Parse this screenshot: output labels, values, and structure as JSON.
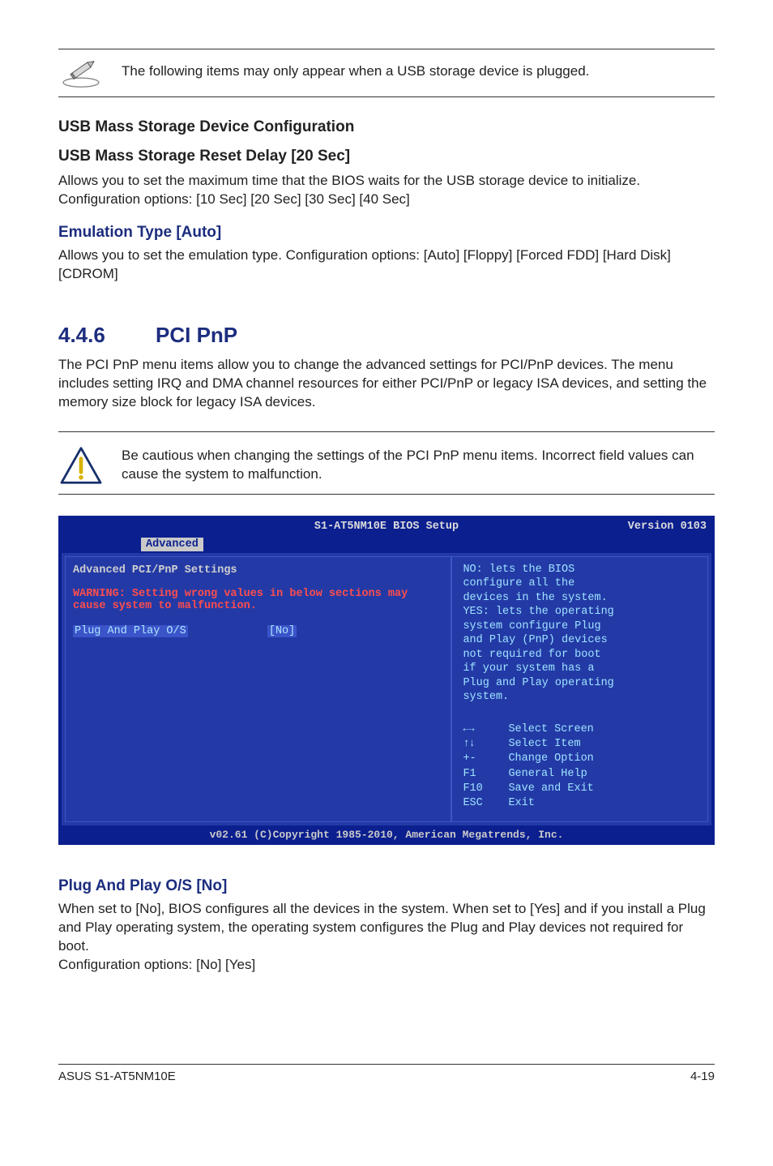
{
  "note_top": {
    "text": "The following items may only appear when a USB storage device is plugged."
  },
  "usb_conf": {
    "heading": "USB Mass Storage Device Configuration",
    "reset_heading": "USB Mass Storage Reset Delay [20 Sec]",
    "reset_body": "Allows you to set the maximum time that the BIOS waits for the USB storage device to initialize. Configuration options: [10 Sec] [20 Sec] [30 Sec] [40 Sec]",
    "emul_heading": "Emulation Type [Auto]",
    "emul_body": "Allows you to set the emulation type. Configuration options: [Auto] [Floppy] [Forced FDD] [Hard Disk] [CDROM]"
  },
  "section": {
    "num": "4.4.6",
    "title": "PCI PnP",
    "body": "The PCI PnP menu items allow you to change the advanced settings for PCI/PnP devices. The menu includes setting IRQ and DMA channel resources for either PCI/PnP or legacy ISA devices, and setting the memory size block for legacy ISA devices."
  },
  "caution": {
    "text": "Be cautious when changing the settings of the PCI PnP menu items. Incorrect field values can cause the system to malfunction."
  },
  "bios": {
    "title_center": "S1-AT5NM10E BIOS Setup",
    "title_right": "Version 0103",
    "tab": "Advanced",
    "left_heading": "Advanced PCI/PnP Settings",
    "left_warn_l1": "WARNING: Setting wrong values in below sections may",
    "left_warn_l2": "cause system to malfunction.",
    "opt_label": "Plug And Play O/S",
    "opt_value": "[No]",
    "help_text_lines": [
      "NO: lets the BIOS",
      "configure  all the",
      "devices in the system.",
      "YES: lets the operating",
      "system configure Plug",
      "and Play (PnP) devices",
      "not required for boot",
      "if your system has a",
      "Plug and Play operating",
      "system."
    ],
    "keys": {
      "select_screen": "Select Screen",
      "select_item": "Select Item",
      "change_option": "Change Option",
      "general_help": "General Help",
      "save_exit": "Save and Exit",
      "exit": "Exit",
      "k_plusminus": "+-",
      "k_f1": "F1",
      "k_f10": "F10",
      "k_esc": "ESC"
    },
    "footer": "v02.61 (C)Copyright 1985-2010, American Megatrends, Inc."
  },
  "plug_play": {
    "heading": "Plug And Play O/S [No]",
    "body": "When set to [No], BIOS configures all the devices in the system. When set to [Yes] and if you install a Plug and Play operating system, the operating system configures the Plug and Play devices not required for boot.",
    "body2": "Configuration options: [No] [Yes]"
  },
  "footer": {
    "left": "ASUS S1-AT5NM10E",
    "right": "4-19"
  }
}
